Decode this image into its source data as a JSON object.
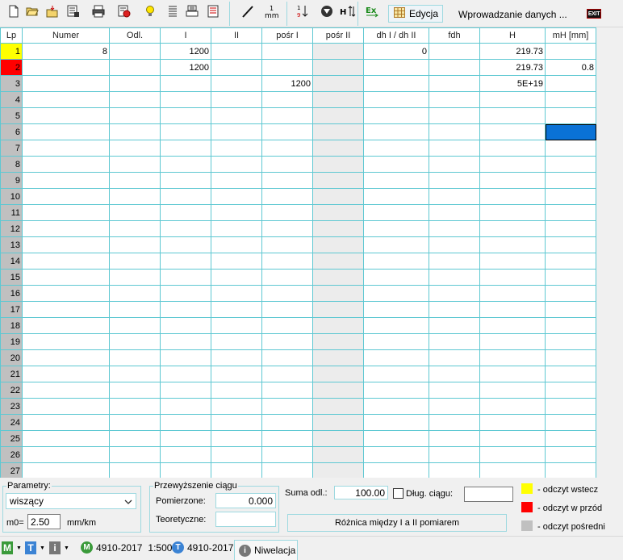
{
  "toolbar": {
    "edycja_label": "Edycja",
    "status_text": "Wprowadzanie danych ...",
    "exit_label": "EXIT"
  },
  "columns": [
    "Lp",
    "Numer",
    "Odl.",
    "I",
    "II",
    "pośr I",
    "pośr II",
    "dh I / dh II",
    "fdh",
    "H",
    "mH [mm]"
  ],
  "rows": [
    {
      "lp": "1",
      "numer": "8",
      "odl": "",
      "i": "1200",
      "ii": "",
      "posr1": "",
      "posr2": "",
      "dh": "0",
      "fdh": "",
      "h": "219.73",
      "mh": "",
      "marker": "yellow"
    },
    {
      "lp": "2",
      "numer": "",
      "odl": "",
      "i": "1200",
      "ii": "",
      "posr1": "",
      "posr2": "",
      "dh": "",
      "fdh": "",
      "h": "219.73",
      "mh": "0.8",
      "marker": "red"
    },
    {
      "lp": "3",
      "numer": "",
      "odl": "",
      "i": "",
      "ii": "",
      "posr1": "1200",
      "posr2": "",
      "dh": "",
      "fdh": "",
      "h": "5E+19",
      "mh": "",
      "marker": ""
    },
    {
      "lp": "4"
    },
    {
      "lp": "5"
    },
    {
      "lp": "6",
      "selected_col": "mh"
    },
    {
      "lp": "7"
    },
    {
      "lp": "8"
    },
    {
      "lp": "9"
    },
    {
      "lp": "10"
    },
    {
      "lp": "11"
    },
    {
      "lp": "12"
    },
    {
      "lp": "13"
    },
    {
      "lp": "14"
    },
    {
      "lp": "15"
    },
    {
      "lp": "16"
    },
    {
      "lp": "17"
    },
    {
      "lp": "18"
    },
    {
      "lp": "19"
    },
    {
      "lp": "20"
    },
    {
      "lp": "21"
    },
    {
      "lp": "22"
    },
    {
      "lp": "23"
    },
    {
      "lp": "24"
    },
    {
      "lp": "25"
    },
    {
      "lp": "26"
    },
    {
      "lp": "27"
    }
  ],
  "colors": {
    "marker_yellow": "#ffff00",
    "marker_red": "#ff0000",
    "selection": "#0a72d6",
    "grid_line": "#5ec8d2",
    "lp_bg": "#c0c0c0",
    "posr2_bg": "#ececec"
  },
  "parametry": {
    "legend": "Parametry:",
    "selected": "wiszący",
    "m0_label": "m0=",
    "m0_value": "2.50",
    "m0_unit": "mm/km"
  },
  "przewyzszenie": {
    "legend": "Przewyższenie ciągu",
    "pomierzone_label": "Pomierzone:",
    "pomierzone_value": "0.000",
    "teoretyczne_label": "Teoretyczne:",
    "teoretyczne_value": ""
  },
  "suma": {
    "label": "Suma odl.:",
    "value": "100.00",
    "dlug_label": "Dług. ciągu:",
    "dlug_value": "",
    "roznica_button": "Różnica między I a II pomiarem"
  },
  "legend_items": [
    {
      "color": "#ffff00",
      "label": "- odczyt wstecz"
    },
    {
      "color": "#ff0000",
      "label": "- odczyt w przód"
    },
    {
      "color": "#c0c0c0",
      "label": "- odczyt pośredni"
    }
  ],
  "statusbar": {
    "m_label": "M",
    "t_label": "T",
    "i_label": "i",
    "map1": "4910-2017",
    "scale": "1:500",
    "map2": "4910-2017",
    "tab": "Niwelacja"
  }
}
